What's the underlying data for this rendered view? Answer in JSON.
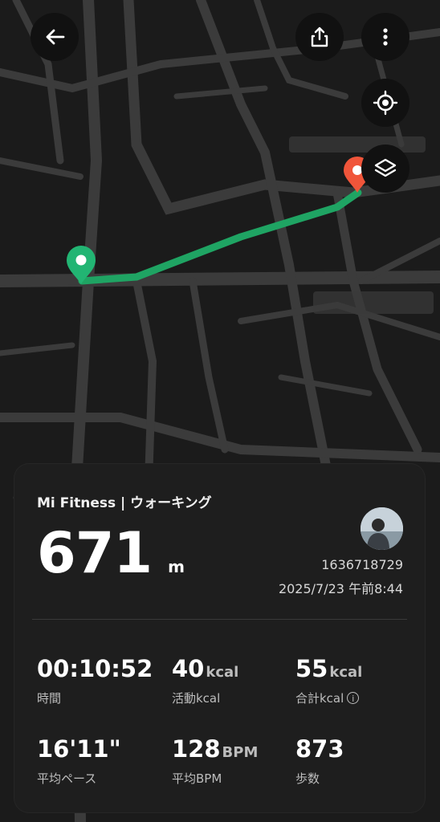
{
  "map": {
    "route_color": "#1fa463",
    "start_color": "#22b573",
    "end_color": "#f0553a"
  },
  "header": {
    "back_icon": "back-arrow-icon",
    "share_icon": "share-icon",
    "more_icon": "more-vert-icon",
    "locate_icon": "locate-icon",
    "layers_icon": "layers-icon"
  },
  "card": {
    "brand": "Mi Fitness | ウォーキング",
    "distance_value": "671",
    "distance_unit": "m",
    "user_id": "1636718729",
    "datetime": "2025/7/23 午前8:44",
    "stats": [
      {
        "value": "00:10:52",
        "unit": "",
        "label": "時間"
      },
      {
        "value": "40",
        "unit": "kcal",
        "label": "活動kcal"
      },
      {
        "value": "55",
        "unit": "kcal",
        "label": "合計kcal"
      },
      {
        "value": "16'11\"",
        "unit": "",
        "label": "平均ペース"
      },
      {
        "value": "128",
        "unit": "BPM",
        "label": "平均BPM"
      },
      {
        "value": "873",
        "unit": "",
        "label": "歩数"
      }
    ]
  }
}
